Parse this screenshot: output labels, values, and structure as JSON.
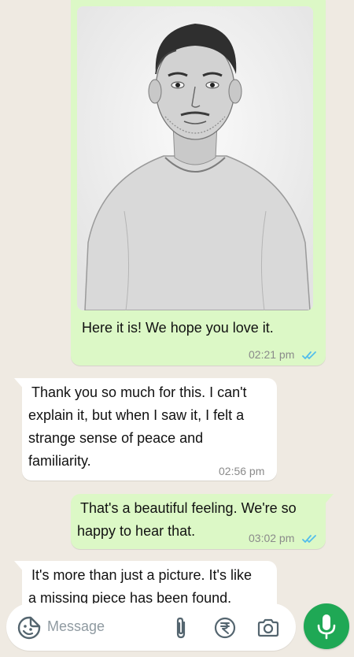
{
  "messages": [
    {
      "direction": "outgoing",
      "has_image": true,
      "image_description": "pencil sketch portrait",
      "text": "Here it is! We hope you love it.",
      "time": "02:21 pm",
      "status": "read"
    },
    {
      "direction": "incoming",
      "lines": [
        "Thank you so much for this. I can't",
        "explain it, but when I saw it, I felt a",
        "strange sense of peace and",
        "familiarity."
      ],
      "time": "02:56 pm"
    },
    {
      "direction": "outgoing",
      "lines": [
        "That's a beautiful feeling. We're so",
        "happy to hear that."
      ],
      "time": "03:02 pm",
      "status": "read"
    },
    {
      "direction": "incoming",
      "lines": [
        "It's more than just a picture. It's like",
        "a missing piece has been found."
      ]
    }
  ],
  "composer": {
    "placeholder": "Message",
    "icons": [
      "sticker-icon",
      "attach-icon",
      "payment-rupee-icon",
      "camera-icon",
      "mic-icon"
    ]
  },
  "colors": {
    "background": "#efeae2",
    "outgoing_bubble": "#dcf8c6",
    "incoming_bubble": "#ffffff",
    "read_ticks": "#53bdeb",
    "mic_button": "#1fa855"
  }
}
